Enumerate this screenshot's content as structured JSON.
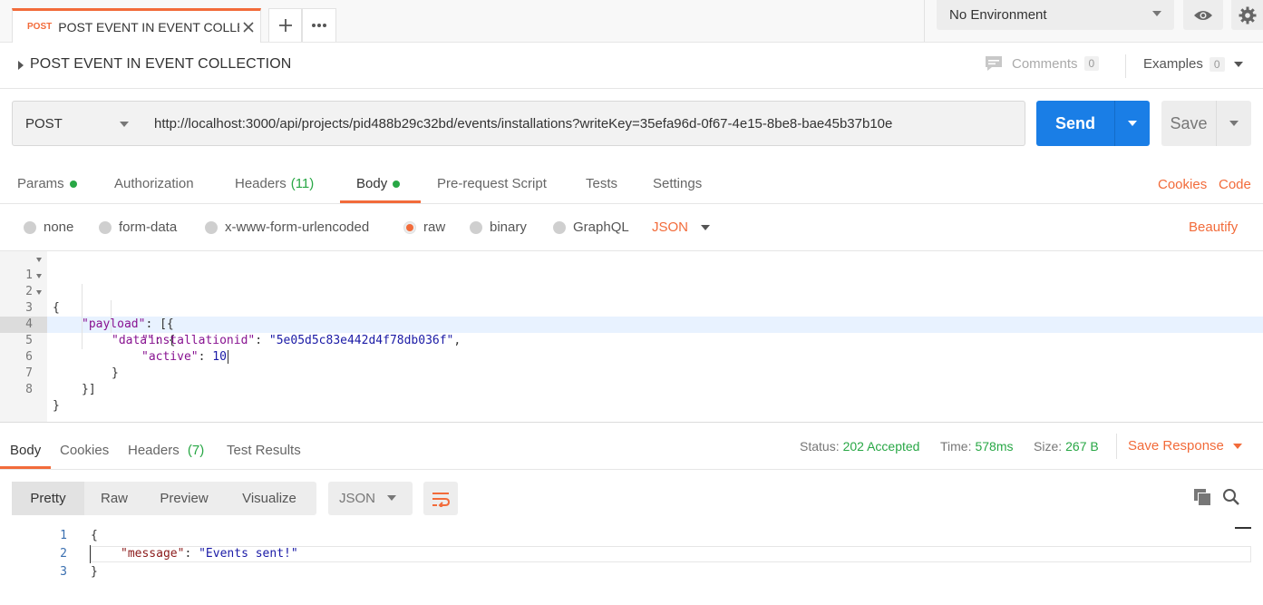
{
  "tab": {
    "method": "POST",
    "name": "POST EVENT IN EVENT COLLE…"
  },
  "environment": {
    "selected": "No Environment"
  },
  "request": {
    "title": "POST EVENT IN EVENT COLLECTION",
    "comments_label": "Comments",
    "comments_count": "0",
    "examples_label": "Examples",
    "examples_count": "0",
    "method": "POST",
    "url": "http://localhost:3000/api/projects/pid488b29c32bd/events/installations?writeKey=35efa96d-0f67-4e15-8be8-bae45b37b10e",
    "send_label": "Send",
    "save_label": "Save"
  },
  "request_tabs": {
    "params": "Params",
    "authorization": "Authorization",
    "headers": "Headers",
    "headers_count": "(11)",
    "body": "Body",
    "pre_request": "Pre-request Script",
    "tests": "Tests",
    "settings": "Settings",
    "cookies": "Cookies",
    "code": "Code"
  },
  "body_types": {
    "none": "none",
    "form_data": "form-data",
    "urlencoded": "x-www-form-urlencoded",
    "raw": "raw",
    "binary": "binary",
    "graphql": "GraphQL",
    "format": "JSON",
    "beautify": "Beautify"
  },
  "editor": {
    "line_numbers": [
      "1",
      "2",
      "3",
      "4",
      "5",
      "6",
      "7",
      "8"
    ],
    "l1": "{",
    "l2_key": "\"payload\"",
    "l2_rest": ": [{",
    "l3_key": "\"data\"",
    "l3_rest": ": {",
    "l4_key": "\"installationid\"",
    "l4_sep": ": ",
    "l4_val": "\"5e05d5c83e442d4f78db036f\"",
    "l4_end": ",",
    "l5_key": "\"active\"",
    "l5_sep": ": ",
    "l5_val": "10",
    "l6": "}",
    "l7": "}]",
    "l8": "}"
  },
  "response_tabs": {
    "body": "Body",
    "cookies": "Cookies",
    "headers": "Headers",
    "headers_count": "(7)",
    "test_results": "Test Results"
  },
  "response_meta": {
    "status_label": "Status:",
    "status_value": "202 Accepted",
    "time_label": "Time:",
    "time_value": "578ms",
    "size_label": "Size:",
    "size_value": "267 B",
    "save_response": "Save Response"
  },
  "response_view": {
    "pretty": "Pretty",
    "raw": "Raw",
    "preview": "Preview",
    "visualize": "Visualize",
    "format": "JSON"
  },
  "response_body": {
    "line_numbers": [
      "1",
      "2",
      "3"
    ],
    "l1": "{",
    "l2_key": "\"message\"",
    "l2_sep": ": ",
    "l2_val": "\"Events sent!\"",
    "l3": "}"
  },
  "colors": {
    "accent": "#f26b3a",
    "send": "#1a7ee6",
    "success": "#28a745"
  }
}
